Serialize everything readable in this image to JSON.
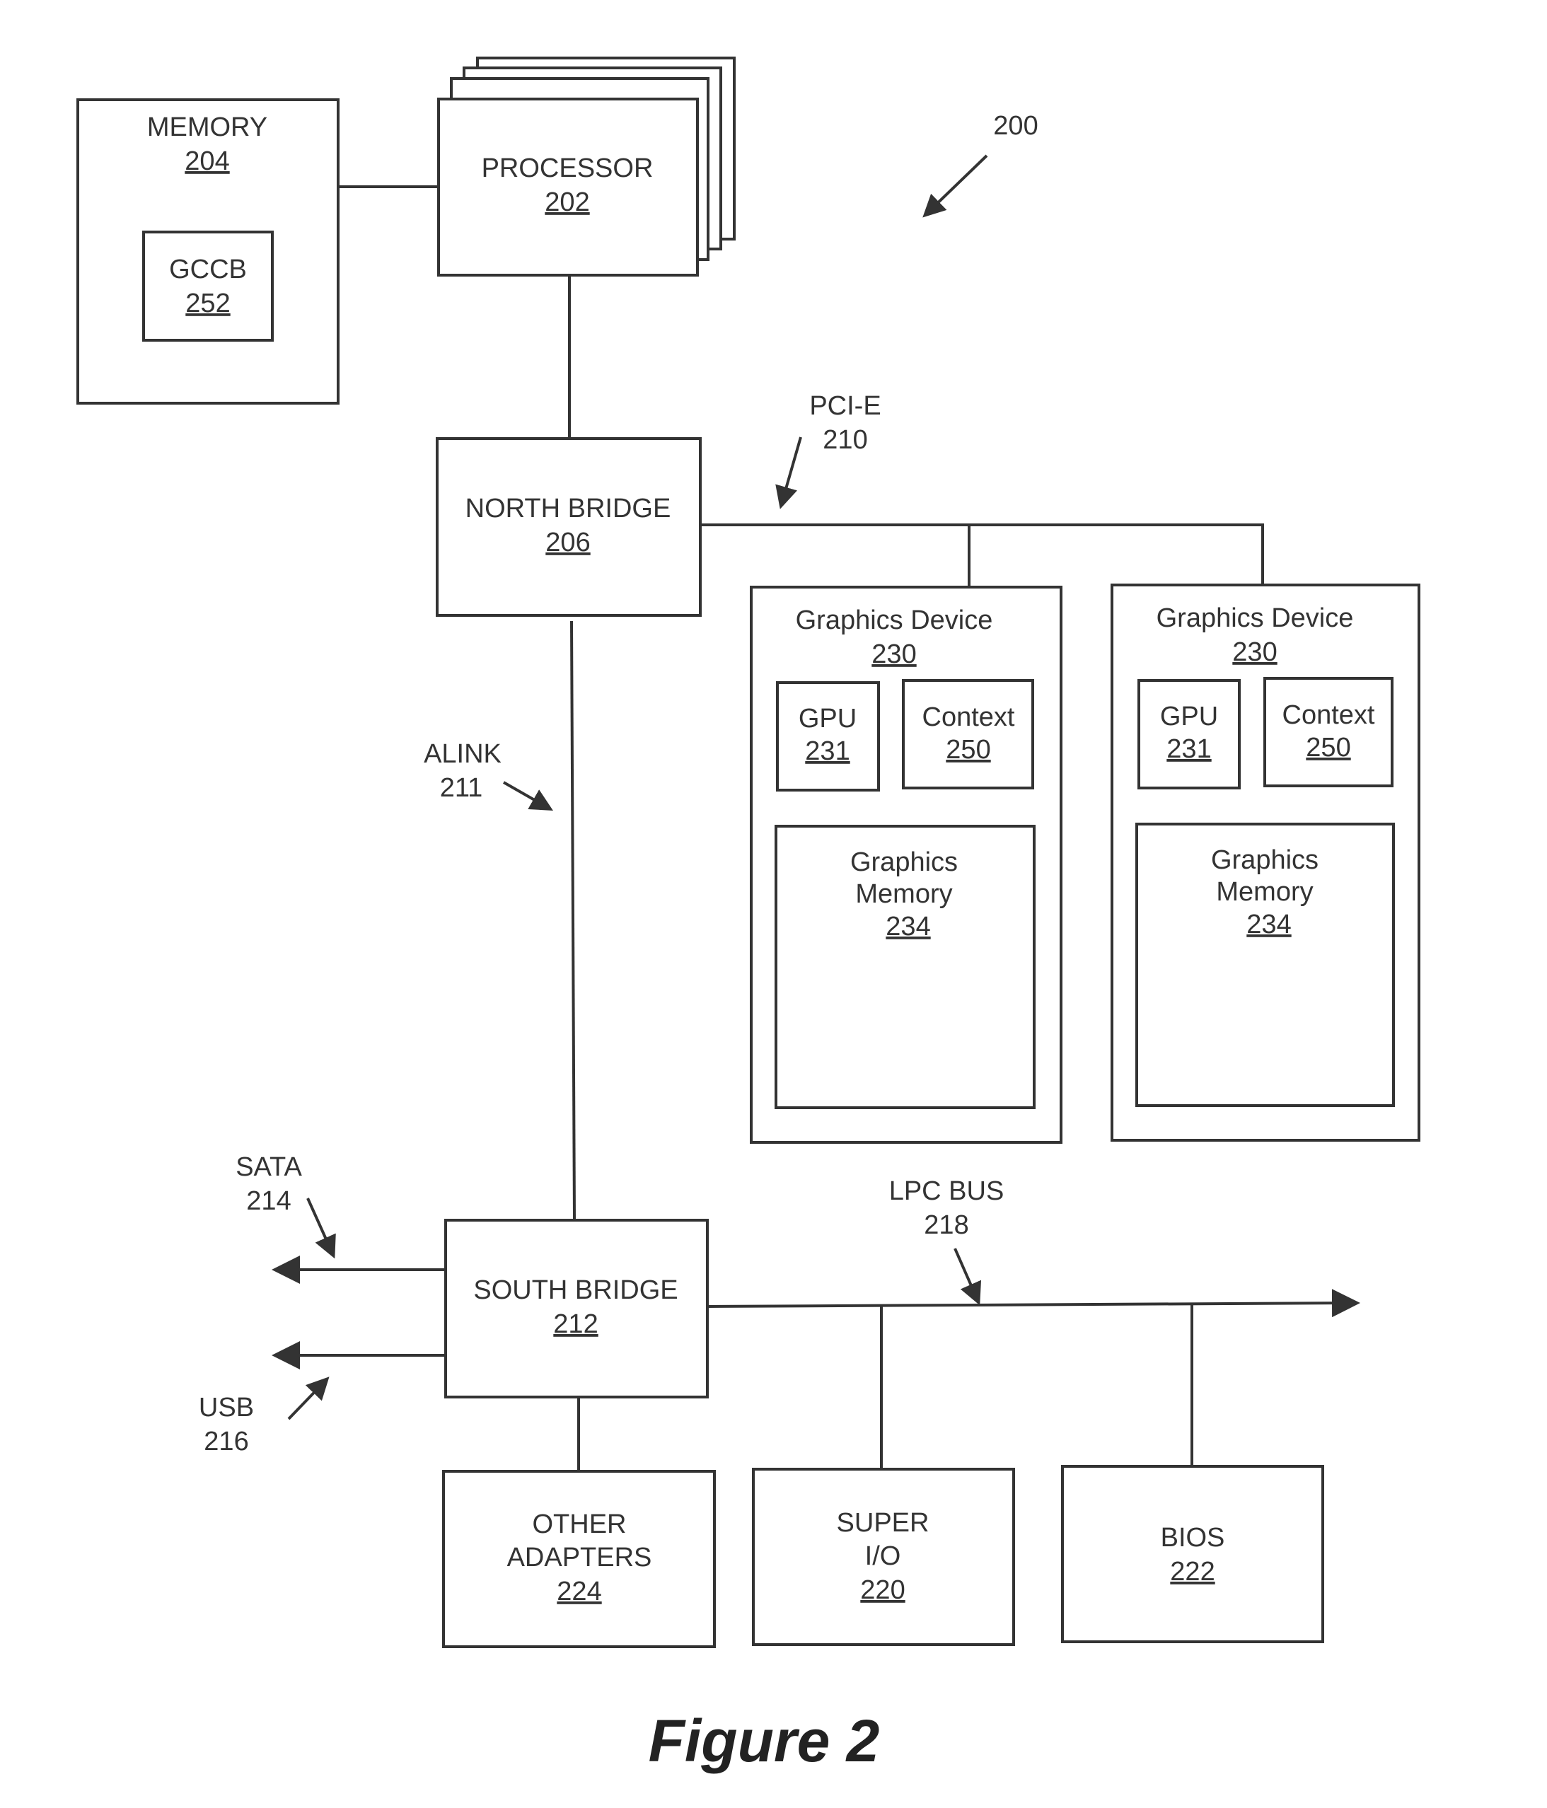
{
  "figure": {
    "caption": "Figure 2",
    "reference": "200"
  },
  "nodes": {
    "memory": {
      "label": "MEMORY",
      "number": "204"
    },
    "gccb": {
      "label": "GCCB",
      "number": "252"
    },
    "processor": {
      "label": "PROCESSOR",
      "number": "202"
    },
    "north_bridge": {
      "label": "NORTH BRIDGE",
      "number": "206"
    },
    "graphics_device_1": {
      "label": "Graphics Device",
      "number": "230",
      "gpu": {
        "label": "GPU",
        "number": "231"
      },
      "context": {
        "label": "Context",
        "number": "250"
      },
      "memory": {
        "label_1": "Graphics",
        "label_2": "Memory",
        "number": "234"
      }
    },
    "graphics_device_2": {
      "label": "Graphics Device",
      "number": "230",
      "gpu": {
        "label": "GPU",
        "number": "231"
      },
      "context": {
        "label": "Context",
        "number": "250"
      },
      "memory": {
        "label_1": "Graphics",
        "label_2": "Memory",
        "number": "234"
      }
    },
    "south_bridge": {
      "label": "SOUTH BRIDGE",
      "number": "212"
    },
    "other_adapters": {
      "label_1": "OTHER",
      "label_2": "ADAPTERS",
      "number": "224"
    },
    "super_io": {
      "label_1": "SUPER",
      "label_2": "I/O",
      "number": "220"
    },
    "bios": {
      "label": "BIOS",
      "number": "222"
    }
  },
  "buses": {
    "pcie": {
      "label": "PCI-E",
      "number": "210"
    },
    "alink": {
      "label": "ALINK",
      "number": "211"
    },
    "sata": {
      "label": "SATA",
      "number": "214"
    },
    "usb": {
      "label": "USB",
      "number": "216"
    },
    "lpc": {
      "label": "LPC BUS",
      "number": "218"
    }
  }
}
